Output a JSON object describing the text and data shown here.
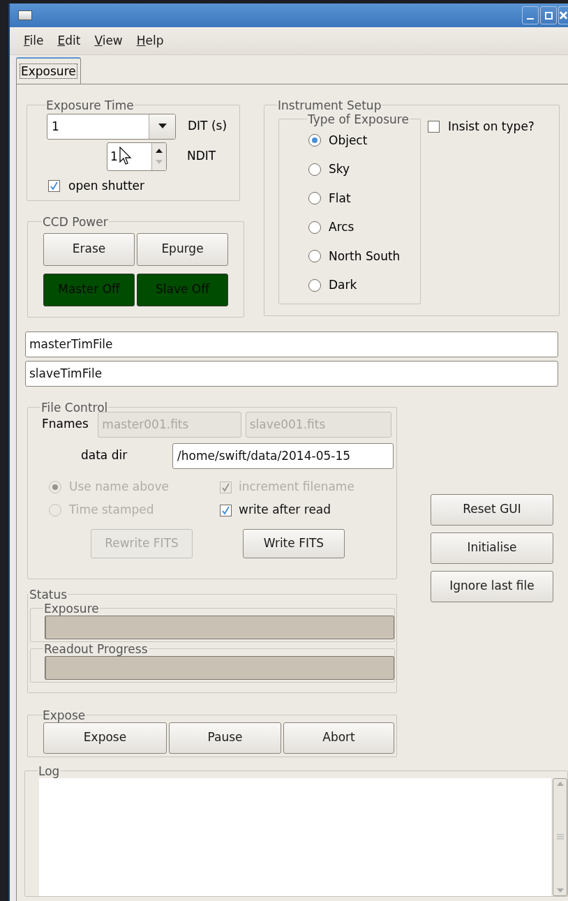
{
  "menu": [
    {
      "label": "File"
    },
    {
      "label": "Edit"
    },
    {
      "label": "View"
    },
    {
      "label": "Help"
    }
  ],
  "tabs": [
    {
      "label": "Exposure",
      "selected": true
    }
  ],
  "exposure_time": {
    "title": "Exposure Time",
    "dit": {
      "value": "1",
      "label": "DIT (s)"
    },
    "ndit": {
      "value": "1",
      "label": "NDIT"
    },
    "open_shutter": {
      "label": "open shutter",
      "checked": true
    }
  },
  "ccd_power": {
    "title": "CCD Power",
    "buttons": [
      {
        "label": "Erase",
        "kind": "normal"
      },
      {
        "label": "Epurge",
        "kind": "normal"
      },
      {
        "label": "Master Off",
        "kind": "power"
      },
      {
        "label": "Slave Off",
        "kind": "power"
      }
    ]
  },
  "instrument_setup": {
    "title": "Instrument Setup",
    "type_title": "Type of Exposure",
    "types": [
      {
        "label": "Object",
        "selected": true
      },
      {
        "label": "Sky",
        "selected": false
      },
      {
        "label": "Flat",
        "selected": false
      },
      {
        "label": "Arcs",
        "selected": false
      },
      {
        "label": "North South",
        "selected": false
      },
      {
        "label": "Dark",
        "selected": false
      }
    ],
    "insist": {
      "label": "Insist on type?",
      "checked": false
    }
  },
  "tim_files": [
    {
      "value": "masterTimFile"
    },
    {
      "value": "slaveTimFile"
    }
  ],
  "file_control": {
    "title": "File Control",
    "fnames_label": "Fnames",
    "fnames": [
      {
        "value": "master001.fits",
        "disabled": true
      },
      {
        "value": "slave001.fits",
        "disabled": true
      }
    ],
    "data_dir": {
      "label": "data dir",
      "value": "/home/swift/data/2014-05-15"
    },
    "naming": [
      {
        "label": "Use name above",
        "selected": true,
        "disabled": true
      },
      {
        "label": "Time stamped",
        "selected": false,
        "disabled": true
      }
    ],
    "options": [
      {
        "label": "increment filename",
        "checked": true,
        "disabled": true
      },
      {
        "label": "write after read",
        "checked": true,
        "disabled": false
      }
    ],
    "buttons": [
      {
        "label": "Rewrite FITS",
        "disabled": true
      },
      {
        "label": "Write FITS",
        "disabled": false
      }
    ]
  },
  "side_buttons": [
    {
      "label": "Reset GUI"
    },
    {
      "label": "Initialise"
    },
    {
      "label": "Ignore last file"
    }
  ],
  "status": {
    "title": "Status",
    "bars": [
      {
        "label": "Exposure",
        "level": 0
      },
      {
        "label": "Readout Progress",
        "level": 0
      }
    ]
  },
  "expose": {
    "title": "Expose",
    "buttons": [
      {
        "label": "Expose"
      },
      {
        "label": "Pause"
      },
      {
        "label": "Abort"
      }
    ]
  },
  "log": {
    "title": "Log"
  }
}
